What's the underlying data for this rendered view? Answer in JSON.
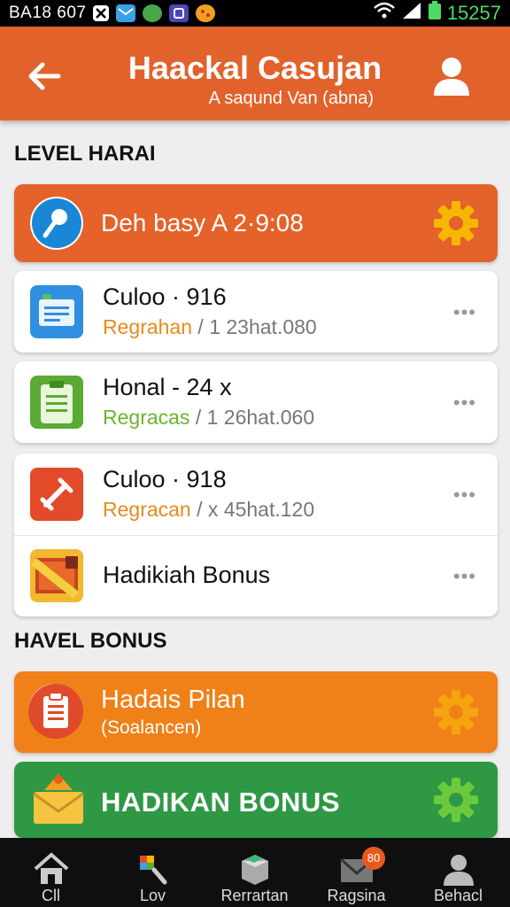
{
  "status_bar": {
    "left_text": "BA18 607",
    "clock": "15257"
  },
  "app_bar": {
    "title": "Haackal Casujan",
    "subtitle": "A saqund Van (abna)"
  },
  "section1": {
    "heading": "LEVEL HARAI",
    "banner_text": "Deh basy A 2·9:08",
    "items": [
      {
        "title": "Culoo · 916",
        "tag": "Regrahan",
        "sep": " / ",
        "meta": "1 23hat.080",
        "tag_color": "#e88a1a"
      },
      {
        "title": "Honal - 24 x",
        "tag": "Regracas",
        "sep": " / ",
        "meta": "1 26hat.060",
        "tag_color": "#6cb42c"
      },
      {
        "title": "Culoo · 918",
        "tag": "Regracan",
        "sep": " / ",
        "meta": "x 45hat.120",
        "tag_color": "#e88a1a"
      },
      {
        "title": "Hadikiah Bonus"
      }
    ],
    "more_label": "•••"
  },
  "section2": {
    "heading": "HAVEL BONUS",
    "bonus1_title": "Hadais Pilan",
    "bonus1_sub": "(Soalancen)",
    "bonus2_title": "HADIKAN BONUS"
  },
  "bottom_nav": {
    "items": [
      {
        "label": "Cll"
      },
      {
        "label": "Lov"
      },
      {
        "label": "Rerrartan"
      },
      {
        "label": "Ragsina",
        "badge": "80"
      },
      {
        "label": "Behacl"
      }
    ]
  },
  "colors": {
    "primary": "#e2622b",
    "orange_banner": "#f08018",
    "green_banner": "#2e9844",
    "gear_yellow": "#f5b800",
    "gear_green": "#6cc93c"
  }
}
